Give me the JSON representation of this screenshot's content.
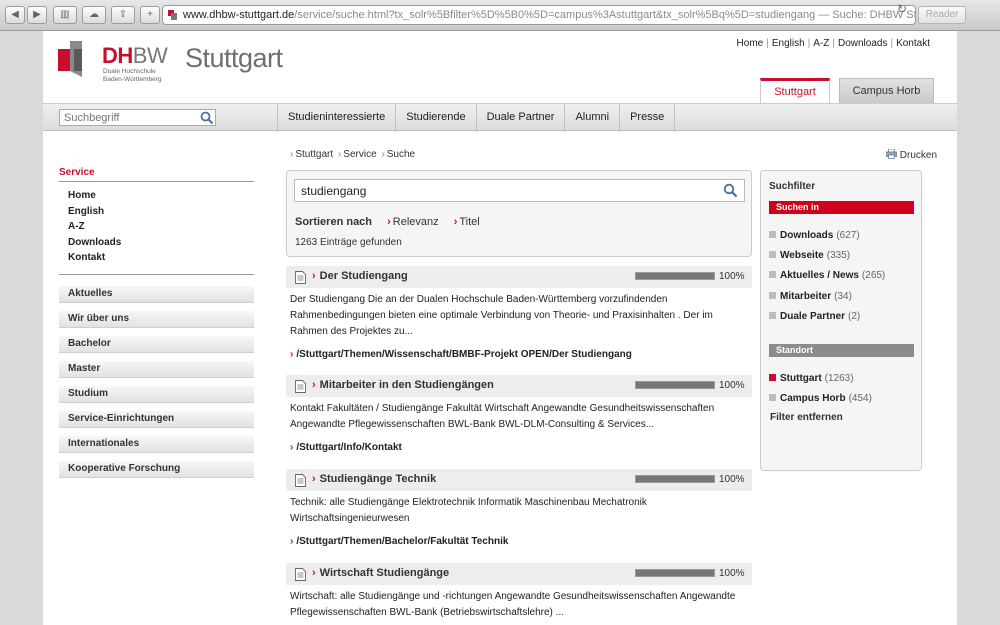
{
  "browser": {
    "url_host": "www.dhbw-stuttgart.de",
    "url_path": "/service/suche.html?tx_solr%5Bfilter%5D%5B0%5D=campus%3Astuttgart&tx_solr%5Bq%5D=studiengang",
    "page_title": " — Suche: DHBW Stuttgart",
    "reader_label": "Reader"
  },
  "header": {
    "logo_dh": "DH",
    "logo_bw": "BW",
    "logo_sub1": "Duale Hochschule",
    "logo_sub2": "Baden-Württemberg",
    "logo_city": "Stuttgart",
    "top_links": [
      "Home",
      "English",
      "A-Z",
      "Downloads",
      "Kontakt"
    ],
    "tab_active": "Stuttgart",
    "tab_other": "Campus Horb"
  },
  "nav": {
    "search_placeholder": "Suchbegriff",
    "items": [
      "Studieninteressierte",
      "Studierende",
      "Duale Partner",
      "Alumni",
      "Presse"
    ]
  },
  "sidebar": {
    "section_title": "Service",
    "service_items": [
      "Home",
      "English",
      "A-Z",
      "Downloads",
      "Kontakt"
    ],
    "categories": [
      "Aktuelles",
      "Wir über uns",
      "Bachelor",
      "Master",
      "Studium",
      "Service-Einrichtungen",
      "Internationales",
      "Kooperative Forschung"
    ]
  },
  "breadcrumb": [
    "Stuttgart",
    "Service",
    "Suche"
  ],
  "print_label": "Drucken",
  "search": {
    "query": "studiengang",
    "sort_label": "Sortieren nach",
    "sort_options": [
      "Relevanz",
      "Titel"
    ],
    "results_count": "1263 Einträge gefunden"
  },
  "results": [
    {
      "title": "Der Studiengang",
      "relevance": "100%",
      "relevance_value": 1.0,
      "snippet": "Der Studiengang Die an der Dualen Hochschule Baden-Württemberg vorzufindenden Rahmenbedingungen bieten eine optimale Verbindung von Theorie- und Praxisinhalten . Der im Rahmen des Projektes zu...",
      "link": "/Stuttgart/Themen/Wissenschaft/BMBF-Projekt OPEN/Der Studiengang"
    },
    {
      "title": "Mitarbeiter in den Studiengängen",
      "relevance": "100%",
      "relevance_value": 1.0,
      "snippet": "Kontakt Fakultäten / Studiengänge Fakultät Wirtschaft Angewandte Gesundheitswissenschaften Angewandte Pflegewissenschaften BWL-Bank BWL-DLM-Consulting & Services...",
      "link": "/Stuttgart/Info/Kontakt"
    },
    {
      "title": "Studiengänge Technik",
      "relevance": "100%",
      "relevance_value": 1.0,
      "snippet": "Technik: alle Studiengänge Elektrotechnik Informatik Maschinenbau Mechatronik Wirtschaftsingenieurwesen",
      "link": "/Stuttgart/Themen/Bachelor/Fakultät Technik"
    },
    {
      "title": "Wirtschaft Studiengänge",
      "relevance": "100%",
      "relevance_value": 1.0,
      "snippet": "Wirtschaft: alle Studiengänge und -richtungen Angewandte Gesundheitswissenschaften Angewandte Pflegewissenschaften BWL-Bank (Betriebswirtschaftslehre) ...",
      "link": ""
    }
  ],
  "filter": {
    "title": "Suchfilter",
    "suchen_in_label": "Suchen in",
    "types": [
      {
        "label": "Downloads",
        "count": "(627)"
      },
      {
        "label": "Webseite",
        "count": "(335)"
      },
      {
        "label": "Aktuelles / News",
        "count": "(265)"
      },
      {
        "label": "Mitarbeiter",
        "count": "(34)"
      },
      {
        "label": "Duale Partner",
        "count": "(2)"
      }
    ],
    "standort_label": "Standort",
    "locations": [
      {
        "label": "Stuttgart",
        "count": "(1263)",
        "active": true
      },
      {
        "label": "Campus Horb",
        "count": "(454)",
        "active": false
      }
    ],
    "remove_label": "Filter entfernen"
  },
  "colors": {
    "accent": "#c8102e",
    "filter_red": "#d0021b",
    "filter_grey": "#8b8b8b"
  }
}
